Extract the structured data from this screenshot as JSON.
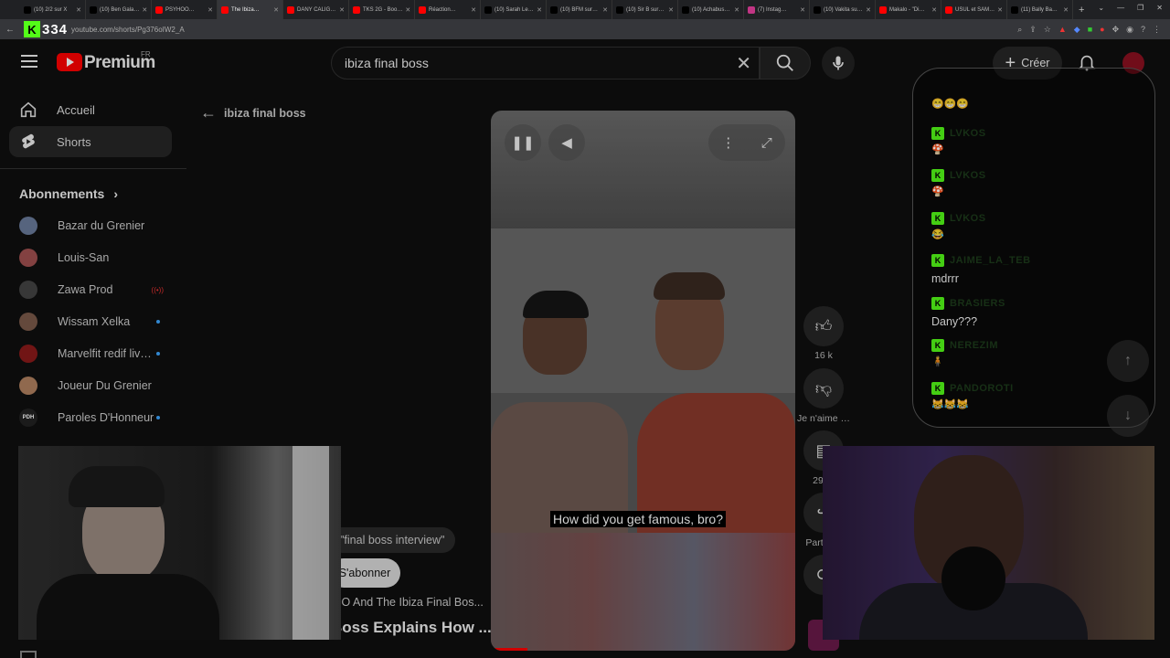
{
  "browser": {
    "tabs": [
      {
        "label": "(10) 2/2 sur X",
        "color": "#000"
      },
      {
        "label": "(10) Ben Gala…",
        "color": "#000"
      },
      {
        "label": "PSYHOO…",
        "color": "#ff0000"
      },
      {
        "label": "The Ibiza…",
        "color": "#ff0000",
        "active": true
      },
      {
        "label": "DANY CALIG…",
        "color": "#ff0000"
      },
      {
        "label": "TKS 2G - Boo…",
        "color": "#ff0000"
      },
      {
        "label": "Réaction…",
        "color": "#ff0000"
      },
      {
        "label": "(10) Sarah Le…",
        "color": "#000"
      },
      {
        "label": "(10) BFM sur…",
        "color": "#000"
      },
      {
        "label": "(10) Sir B sur…",
        "color": "#000"
      },
      {
        "label": "(10) Achabus…",
        "color": "#000"
      },
      {
        "label": "(7) Instag…",
        "color": "#c13584"
      },
      {
        "label": "(10) Vakita su…",
        "color": "#000"
      },
      {
        "label": "Makalo - \"Di…",
        "color": "#ff0000"
      },
      {
        "label": "USUL et SAM…",
        "color": "#ff0000"
      },
      {
        "label": "(11) Bally Ba…",
        "color": "#000"
      }
    ],
    "new_tab": "+",
    "url": "youtube.com/shorts/Pg376oIW2_A",
    "overlay_text": "334"
  },
  "header": {
    "brand": "Premium",
    "region": "FR",
    "search_value": "ibiza final boss",
    "create_label": "Créer"
  },
  "sidebar": {
    "items": [
      {
        "label": "Accueil",
        "icon": "home-icon"
      },
      {
        "label": "Shorts",
        "icon": "shorts-icon"
      }
    ],
    "subscriptions_title": "Abonnements",
    "subscriptions": [
      {
        "label": "Bazar du Grenier",
        "color": "#6a7a9a"
      },
      {
        "label": "Louis-San",
        "color": "#a05050"
      },
      {
        "label": "Zawa Prod",
        "color": "#444",
        "live": true
      },
      {
        "label": "Wissam Xelka",
        "color": "#7a5a4a",
        "dot": true
      },
      {
        "label": "Marvelfit redif liv…",
        "color": "#8a1a1a",
        "dot": true
      },
      {
        "label": "Joueur Du Grenier",
        "color": "#b08060"
      },
      {
        "label": "Paroles D'Honneur",
        "color": "#222",
        "dot": true,
        "badge": "PDH"
      }
    ]
  },
  "page": {
    "back_label": "ibiza final boss",
    "search_chip": "\"final boss interview\"",
    "subscribe_label": "S'abonner",
    "video_channel": "IO And The Ibiza Final Bos...",
    "video_title": "Boss Explains How ..."
  },
  "short": {
    "caption": "How did you get famous, bro?",
    "likes": "16 k",
    "dislike_label": "Je n'aime …",
    "comments": "29",
    "share_label": "Part"
  },
  "chat": {
    "top_emotes": "😁😁😁",
    "messages": [
      {
        "user": "LVKOS",
        "text": "",
        "emote": "🍄"
      },
      {
        "user": "LVKOS",
        "text": "",
        "emote": "🍄"
      },
      {
        "user": "LVKOS",
        "text": "",
        "emote": "😂"
      },
      {
        "user": "JAIME_LA_TEB",
        "text": "mdrrr",
        "emote": ""
      },
      {
        "user": "BRASIERS",
        "text": "Dany???",
        "emote": ""
      },
      {
        "user": "NEREZIM",
        "text": "",
        "emote": "🧍"
      },
      {
        "user": "PANDOROTI",
        "text": "",
        "emote": "😹😹😹"
      }
    ]
  }
}
